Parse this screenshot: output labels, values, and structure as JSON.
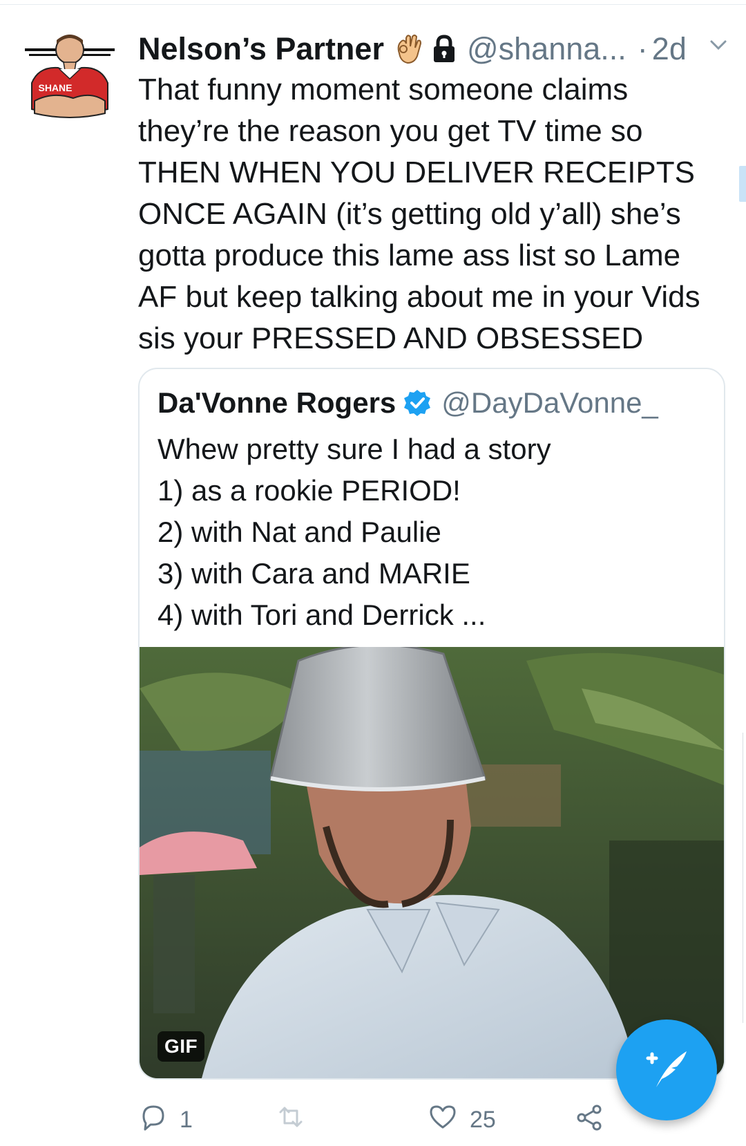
{
  "tweet": {
    "avatar_text": "SHANE",
    "display_name": "Nelson’s Partner",
    "handle": "@shanna...",
    "separator": "·",
    "time": "2d",
    "text_lines": [
      "That funny moment someone claims",
      "they’re the reason you get TV time so",
      "THEN WHEN YOU DELIVER RECEIPTS",
      "ONCE AGAIN (it’s getting old y’all) she’s",
      "gotta produce this lame ass list so Lame",
      "AF but keep talking about me in your Vids",
      "sis your PRESSED AND OBSESSED"
    ]
  },
  "quoted_tweet": {
    "display_name": "Da'Vonne Rogers",
    "handle": "@DayDaVonne_",
    "text_lines": [
      "Whew pretty sure I had a story",
      "1) as a rookie PERIOD!",
      "2) with Nat and Paulie",
      "3) with Cara and MARIE",
      "4) with Tori and Derrick ..."
    ],
    "media_badge": "GIF"
  },
  "actions": {
    "reply_count": "1",
    "retweet_count": "",
    "like_count": "25"
  },
  "icons": {
    "emoji": "ok-hand-icon",
    "lock": "lock-icon",
    "verified": "verified-badge-icon",
    "chevron": "chevron-down-icon",
    "reply": "reply-icon",
    "retweet": "retweet-icon",
    "like": "heart-icon",
    "share": "share-icon",
    "compose": "compose-tweet-icon"
  },
  "colors": {
    "accent": "#1da1f2",
    "text": "#14171a",
    "secondary": "#657786",
    "border": "#e1e8ed"
  }
}
